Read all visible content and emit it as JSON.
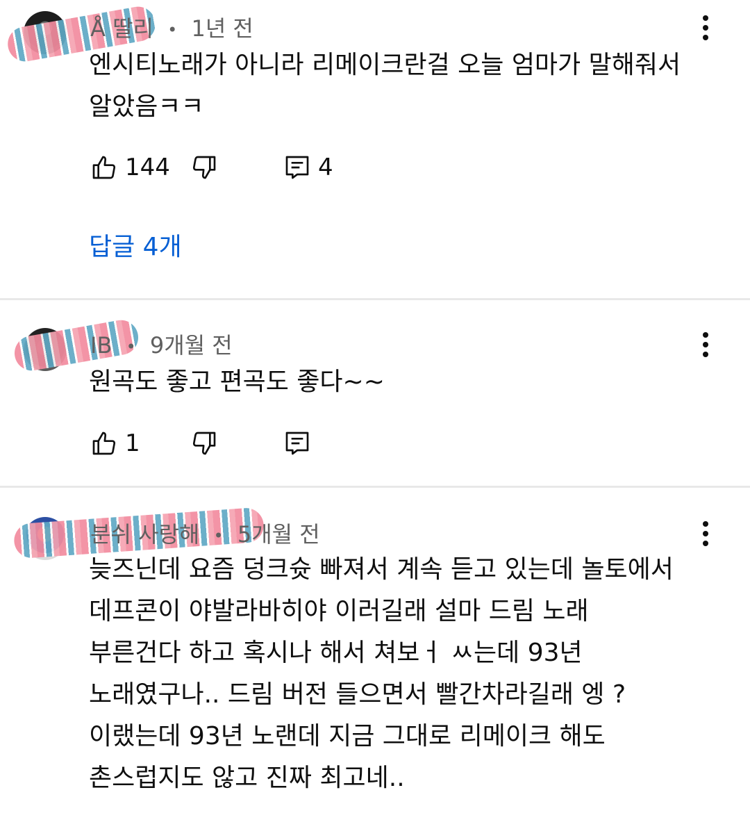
{
  "comments": [
    {
      "author": "Å 딸리",
      "time": "1년 전",
      "text": "엔시티노래가 아니라 리메이크란걸 오늘 엄마가 말해줘서\n알았음ㅋㅋ",
      "likes": "144",
      "replies_count": "4",
      "replies_link": "답글 4개"
    },
    {
      "author": "IB",
      "time": "9개월 전",
      "text": "원곡도 좋고 편곡도 좋다~~",
      "likes": "1"
    },
    {
      "author": "분쉬 사랑해",
      "time": "5개월 전",
      "text": "늦즈닌데 요즘 덩크슛 빠져서 계속 듣고 있는데 놀토에서\n데프콘이 야발라바히야 이러길래 설마 드림 노래\n부른건다 하고 혹시나 해서 쳐보ㅓ ㅆ는데 93년\n노래였구나.. 드림 버전 들으면서 빨간차라길래 엥 ?\n이랬는데 93년 노랜데 지금 그대로 리메이크 해도\n촌스럽지도 않고 진짜 최고네.."
    }
  ],
  "separator": "•",
  "icons": [
    "like-icon",
    "dislike-icon",
    "reply-icon",
    "more-vert-icon"
  ],
  "colors": {
    "link": "#065fd4",
    "meta": "#606060",
    "divider": "#e8e8e8"
  }
}
